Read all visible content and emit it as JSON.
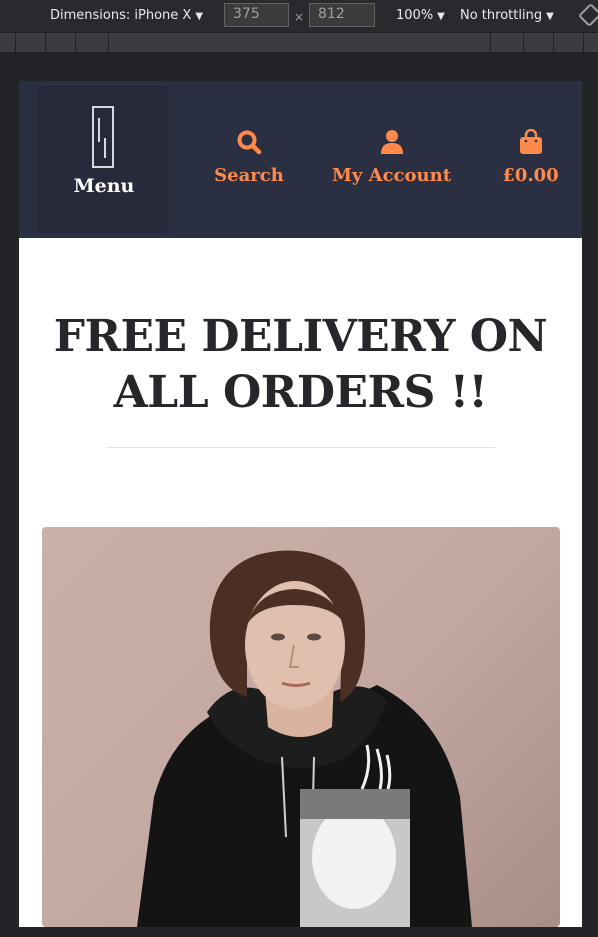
{
  "devtools": {
    "dimensions_label": "Dimensions: iPhone X",
    "width_value": "375",
    "height_value": "812",
    "times_sign": "×",
    "zoom": "100%",
    "throttling": "No throttling"
  },
  "header": {
    "menu_label": "Menu",
    "nav": [
      {
        "label": "Search",
        "icon": "search-icon"
      },
      {
        "label": "My Account",
        "icon": "user-icon"
      },
      {
        "label": "£0.00",
        "icon": "shopping-bag-icon"
      }
    ],
    "accent_color": "#ff8a4c",
    "background_color": "#2b2f42"
  },
  "promo": {
    "line1": "FREE DELIVERY ON",
    "line2": "ALL ORDERS !!"
  },
  "product_image": {
    "subject": "model-in-black-hoodie"
  }
}
